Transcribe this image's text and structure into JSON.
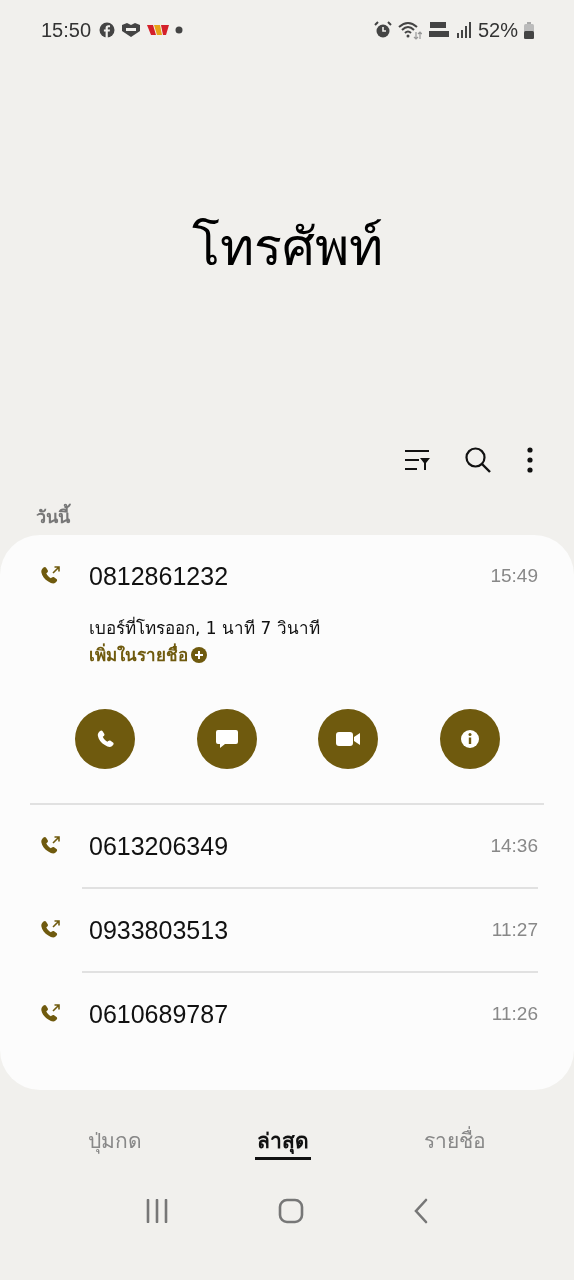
{
  "status_bar": {
    "time": "15:50",
    "battery": "52%"
  },
  "title": "โทรศัพท์",
  "section": "วันนี้",
  "calls": [
    {
      "number": "0812861232",
      "time": "15:49",
      "expanded": true,
      "detail": "เบอร์ที่โทรออก, 1 นาที 7 วินาที",
      "add_contact": "เพิ่มในรายชื่อ"
    },
    {
      "number": "0613206349",
      "time": "14:36",
      "expanded": false
    },
    {
      "number": "0933803513",
      "time": "11:27",
      "expanded": false
    },
    {
      "number": "0610689787",
      "time": "11:26",
      "expanded": false
    }
  ],
  "tabs": [
    {
      "label": "ปุ่มกด",
      "selected": false
    },
    {
      "label": "ล่าสุด",
      "selected": true
    },
    {
      "label": "รายชื่อ",
      "selected": false
    }
  ]
}
